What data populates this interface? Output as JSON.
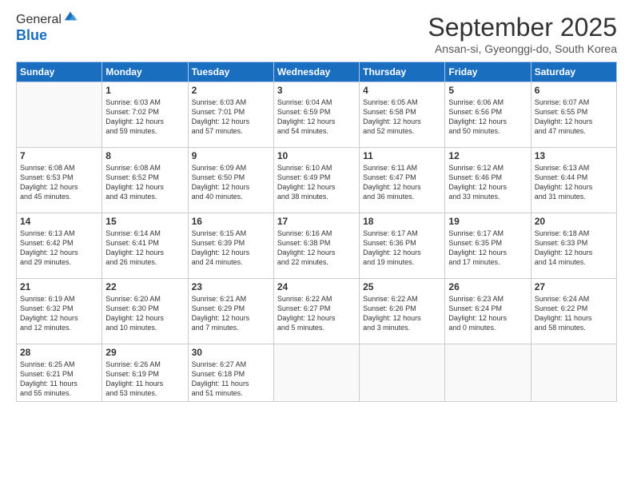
{
  "header": {
    "logo_line1": "General",
    "logo_line2": "Blue",
    "month_title": "September 2025",
    "location": "Ansan-si, Gyeonggi-do, South Korea"
  },
  "weekdays": [
    "Sunday",
    "Monday",
    "Tuesday",
    "Wednesday",
    "Thursday",
    "Friday",
    "Saturday"
  ],
  "weeks": [
    [
      {
        "day": "",
        "info": ""
      },
      {
        "day": "1",
        "info": "Sunrise: 6:03 AM\nSunset: 7:02 PM\nDaylight: 12 hours\nand 59 minutes."
      },
      {
        "day": "2",
        "info": "Sunrise: 6:03 AM\nSunset: 7:01 PM\nDaylight: 12 hours\nand 57 minutes."
      },
      {
        "day": "3",
        "info": "Sunrise: 6:04 AM\nSunset: 6:59 PM\nDaylight: 12 hours\nand 54 minutes."
      },
      {
        "day": "4",
        "info": "Sunrise: 6:05 AM\nSunset: 6:58 PM\nDaylight: 12 hours\nand 52 minutes."
      },
      {
        "day": "5",
        "info": "Sunrise: 6:06 AM\nSunset: 6:56 PM\nDaylight: 12 hours\nand 50 minutes."
      },
      {
        "day": "6",
        "info": "Sunrise: 6:07 AM\nSunset: 6:55 PM\nDaylight: 12 hours\nand 47 minutes."
      }
    ],
    [
      {
        "day": "7",
        "info": "Sunrise: 6:08 AM\nSunset: 6:53 PM\nDaylight: 12 hours\nand 45 minutes."
      },
      {
        "day": "8",
        "info": "Sunrise: 6:08 AM\nSunset: 6:52 PM\nDaylight: 12 hours\nand 43 minutes."
      },
      {
        "day": "9",
        "info": "Sunrise: 6:09 AM\nSunset: 6:50 PM\nDaylight: 12 hours\nand 40 minutes."
      },
      {
        "day": "10",
        "info": "Sunrise: 6:10 AM\nSunset: 6:49 PM\nDaylight: 12 hours\nand 38 minutes."
      },
      {
        "day": "11",
        "info": "Sunrise: 6:11 AM\nSunset: 6:47 PM\nDaylight: 12 hours\nand 36 minutes."
      },
      {
        "day": "12",
        "info": "Sunrise: 6:12 AM\nSunset: 6:46 PM\nDaylight: 12 hours\nand 33 minutes."
      },
      {
        "day": "13",
        "info": "Sunrise: 6:13 AM\nSunset: 6:44 PM\nDaylight: 12 hours\nand 31 minutes."
      }
    ],
    [
      {
        "day": "14",
        "info": "Sunrise: 6:13 AM\nSunset: 6:42 PM\nDaylight: 12 hours\nand 29 minutes."
      },
      {
        "day": "15",
        "info": "Sunrise: 6:14 AM\nSunset: 6:41 PM\nDaylight: 12 hours\nand 26 minutes."
      },
      {
        "day": "16",
        "info": "Sunrise: 6:15 AM\nSunset: 6:39 PM\nDaylight: 12 hours\nand 24 minutes."
      },
      {
        "day": "17",
        "info": "Sunrise: 6:16 AM\nSunset: 6:38 PM\nDaylight: 12 hours\nand 22 minutes."
      },
      {
        "day": "18",
        "info": "Sunrise: 6:17 AM\nSunset: 6:36 PM\nDaylight: 12 hours\nand 19 minutes."
      },
      {
        "day": "19",
        "info": "Sunrise: 6:17 AM\nSunset: 6:35 PM\nDaylight: 12 hours\nand 17 minutes."
      },
      {
        "day": "20",
        "info": "Sunrise: 6:18 AM\nSunset: 6:33 PM\nDaylight: 12 hours\nand 14 minutes."
      }
    ],
    [
      {
        "day": "21",
        "info": "Sunrise: 6:19 AM\nSunset: 6:32 PM\nDaylight: 12 hours\nand 12 minutes."
      },
      {
        "day": "22",
        "info": "Sunrise: 6:20 AM\nSunset: 6:30 PM\nDaylight: 12 hours\nand 10 minutes."
      },
      {
        "day": "23",
        "info": "Sunrise: 6:21 AM\nSunset: 6:29 PM\nDaylight: 12 hours\nand 7 minutes."
      },
      {
        "day": "24",
        "info": "Sunrise: 6:22 AM\nSunset: 6:27 PM\nDaylight: 12 hours\nand 5 minutes."
      },
      {
        "day": "25",
        "info": "Sunrise: 6:22 AM\nSunset: 6:26 PM\nDaylight: 12 hours\nand 3 minutes."
      },
      {
        "day": "26",
        "info": "Sunrise: 6:23 AM\nSunset: 6:24 PM\nDaylight: 12 hours\nand 0 minutes."
      },
      {
        "day": "27",
        "info": "Sunrise: 6:24 AM\nSunset: 6:22 PM\nDaylight: 11 hours\nand 58 minutes."
      }
    ],
    [
      {
        "day": "28",
        "info": "Sunrise: 6:25 AM\nSunset: 6:21 PM\nDaylight: 11 hours\nand 55 minutes."
      },
      {
        "day": "29",
        "info": "Sunrise: 6:26 AM\nSunset: 6:19 PM\nDaylight: 11 hours\nand 53 minutes."
      },
      {
        "day": "30",
        "info": "Sunrise: 6:27 AM\nSunset: 6:18 PM\nDaylight: 11 hours\nand 51 minutes."
      },
      {
        "day": "",
        "info": ""
      },
      {
        "day": "",
        "info": ""
      },
      {
        "day": "",
        "info": ""
      },
      {
        "day": "",
        "info": ""
      }
    ]
  ]
}
